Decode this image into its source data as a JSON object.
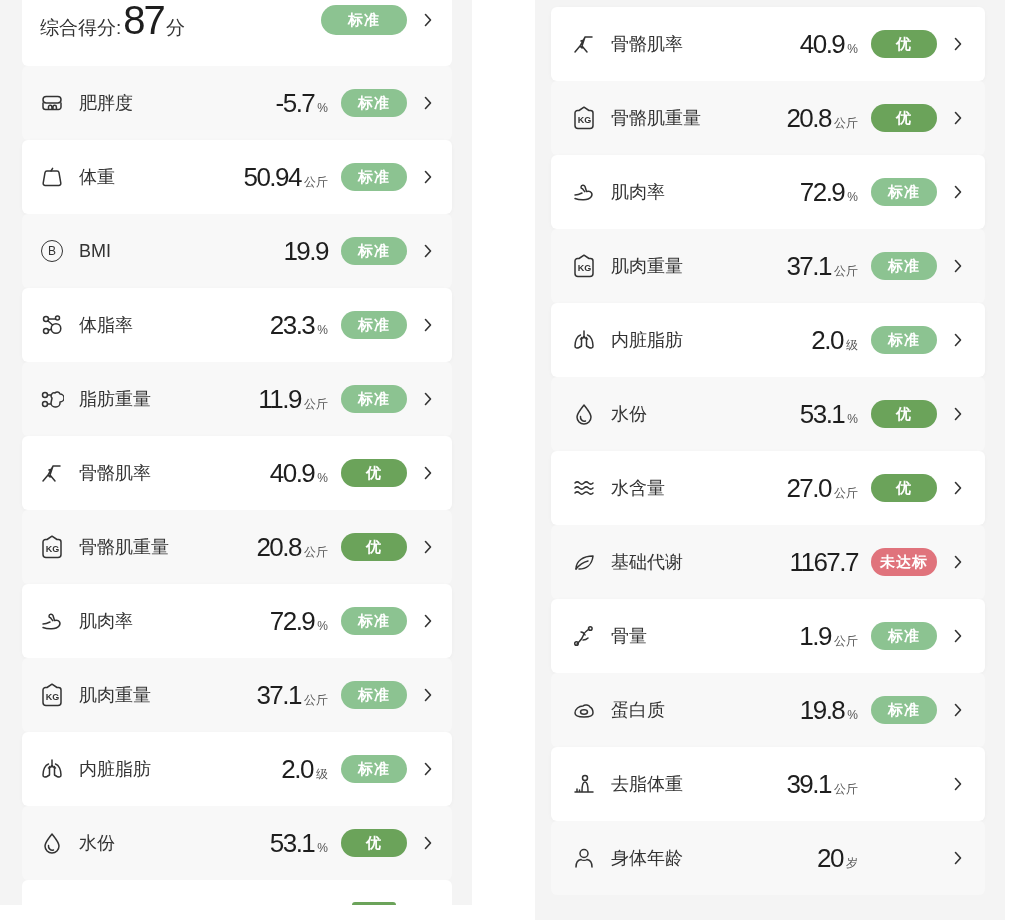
{
  "left_panel": {
    "summary": {
      "label": "综合得分:",
      "score": "87",
      "unit": "分",
      "badge": {
        "text": "标准",
        "color": "#8cc391"
      }
    },
    "rows": [
      {
        "kind": "obesity",
        "name": "肥胖度",
        "value": "-5.7",
        "unit": "%",
        "badge": {
          "text": "标准",
          "color": "#8cc391"
        }
      },
      {
        "kind": "weight",
        "name": "体重",
        "value": "50.94",
        "unit": "公斤",
        "badge": {
          "text": "标准",
          "color": "#8cc391"
        }
      },
      {
        "kind": "bmi",
        "icon_glyph": "B",
        "name": "BMI",
        "value": "19.9",
        "badge": {
          "text": "标准",
          "color": "#8cc391"
        }
      },
      {
        "kind": "bodyfat",
        "name": "体脂率",
        "value": "23.3",
        "unit": "%",
        "badge": {
          "text": "标准",
          "color": "#8cc391"
        }
      },
      {
        "kind": "fatmass",
        "name": "脂肪重量",
        "value": "11.9",
        "unit": "公斤",
        "badge": {
          "text": "标准",
          "color": "#8cc391"
        }
      },
      {
        "kind": "skeletal",
        "name": "骨骼肌率",
        "value": "40.9",
        "unit": "%",
        "badge": {
          "text": "优",
          "color": "#6ba35a"
        }
      },
      {
        "kind": "skeletalmass",
        "icon_glyph": "KG",
        "name": "骨骼肌重量",
        "value": "20.8",
        "unit": "公斤",
        "badge": {
          "text": "优",
          "color": "#6ba35a"
        }
      },
      {
        "kind": "muscle",
        "name": "肌肉率",
        "value": "72.9",
        "unit": "%",
        "badge": {
          "text": "标准",
          "color": "#8cc391"
        }
      },
      {
        "kind": "musclemass",
        "icon_glyph": "KG",
        "name": "肌肉重量",
        "value": "37.1",
        "unit": "公斤",
        "badge": {
          "text": "标准",
          "color": "#8cc391"
        }
      },
      {
        "kind": "visceral",
        "name": "内脏脂肪",
        "value": "2.0",
        "unit": "级",
        "badge": {
          "text": "标准",
          "color": "#8cc391"
        }
      },
      {
        "kind": "water",
        "name": "水份",
        "value": "53.1",
        "unit": "%",
        "badge": {
          "text": "优",
          "color": "#6ba35a"
        }
      }
    ],
    "cut_row": {
      "badge": {
        "color": "#6ba35a"
      }
    }
  },
  "right_panel": {
    "rows": [
      {
        "kind": "skeletal",
        "name": "骨骼肌率",
        "value": "40.9",
        "unit": "%",
        "badge": {
          "text": "优",
          "color": "#6ba35a"
        }
      },
      {
        "kind": "skeletalmass",
        "icon_glyph": "KG",
        "name": "骨骼肌重量",
        "value": "20.8",
        "unit": "公斤",
        "badge": {
          "text": "优",
          "color": "#6ba35a"
        }
      },
      {
        "kind": "muscle",
        "name": "肌肉率",
        "value": "72.9",
        "unit": "%",
        "badge": {
          "text": "标准",
          "color": "#8cc391"
        }
      },
      {
        "kind": "musclemass",
        "icon_glyph": "KG",
        "name": "肌肉重量",
        "value": "37.1",
        "unit": "公斤",
        "badge": {
          "text": "标准",
          "color": "#8cc391"
        }
      },
      {
        "kind": "visceral",
        "name": "内脏脂肪",
        "value": "2.0",
        "unit": "级",
        "badge": {
          "text": "标准",
          "color": "#8cc391"
        }
      },
      {
        "kind": "water",
        "name": "水份",
        "value": "53.1",
        "unit": "%",
        "badge": {
          "text": "优",
          "color": "#6ba35a"
        }
      },
      {
        "kind": "watermass",
        "name": "水含量",
        "value": "27.0",
        "unit": "公斤",
        "badge": {
          "text": "优",
          "color": "#6ba35a"
        }
      },
      {
        "kind": "metabolism",
        "name": "基础代谢",
        "value": "1167.7",
        "badge": {
          "text": "未达标",
          "color": "#e0737c"
        }
      },
      {
        "kind": "bone",
        "name": "骨量",
        "value": "1.9",
        "unit": "公斤",
        "badge": {
          "text": "标准",
          "color": "#8cc391"
        }
      },
      {
        "kind": "protein",
        "name": "蛋白质",
        "value": "19.8",
        "unit": "%",
        "badge": {
          "text": "标准",
          "color": "#8cc391"
        }
      },
      {
        "kind": "leanmass",
        "name": "去脂体重",
        "value": "39.1",
        "unit": "公斤"
      },
      {
        "kind": "bodyage",
        "name": "身体年龄",
        "value": "20",
        "unit": "岁"
      }
    ]
  }
}
